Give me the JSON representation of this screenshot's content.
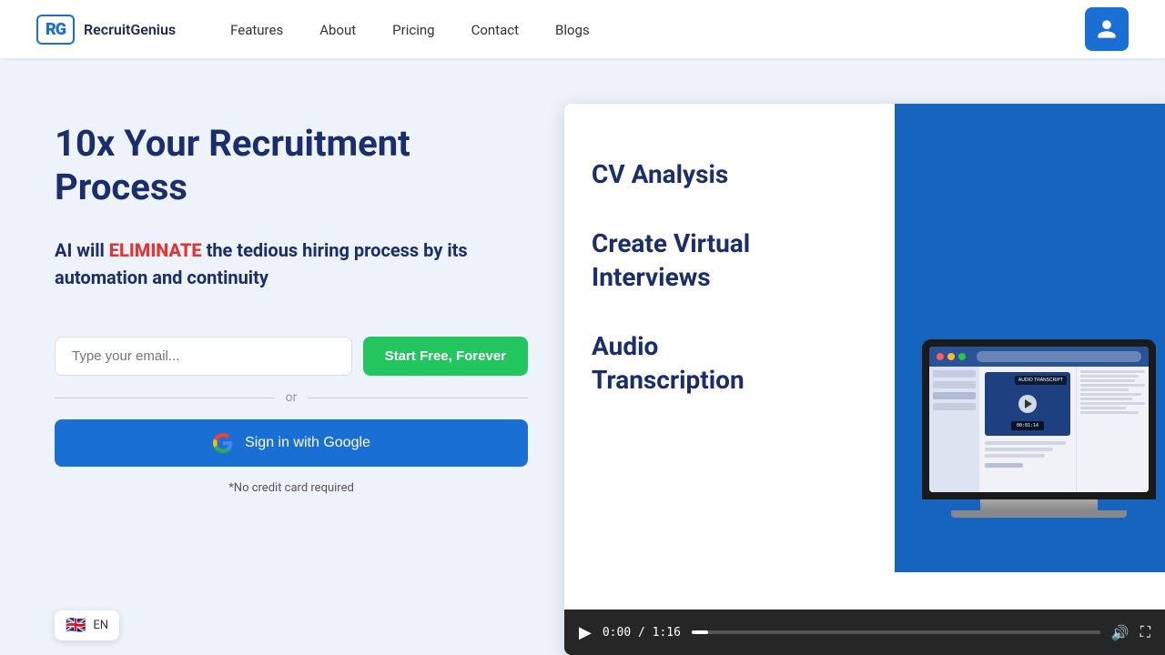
{
  "brand": {
    "logo_rg": "RG",
    "logo_name": "RecruitGenius"
  },
  "nav": {
    "features": "Features",
    "about": "About",
    "pricing": "Pricing",
    "contact": "Contact",
    "blogs": "Blogs"
  },
  "hero": {
    "headline": "10x Your Recruitment Process",
    "subheadline_prefix": "AI will ",
    "subheadline_highlight": "ELIMINATE",
    "subheadline_suffix": " the tedious hiring process by its automation and continuity",
    "email_placeholder": "Type your email...",
    "cta_button": "Start Free, Forever",
    "divider_or": "or",
    "google_button": "Sign in with Google",
    "no_credit": "*No credit card required"
  },
  "features": {
    "items": [
      {
        "label": "CV Analysis"
      },
      {
        "label": "Create Virtual Interviews"
      },
      {
        "label": "Audio Transcription"
      }
    ]
  },
  "video": {
    "time": "0:00 / 1:16"
  },
  "colors": {
    "primary": "#1a6fd4",
    "headline": "#1a2d6d",
    "highlight": "#e63232",
    "cta": "#22c55e",
    "background": "#eef2fb"
  }
}
